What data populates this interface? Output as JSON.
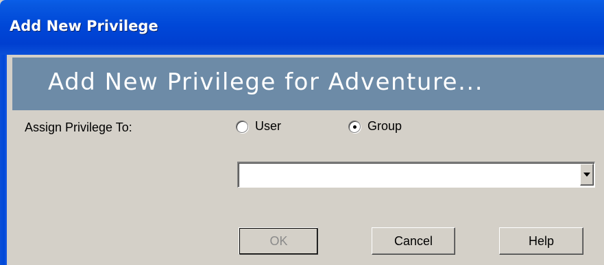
{
  "window": {
    "title": "Add New Privilege"
  },
  "header": {
    "title": "Add New Privilege for Adventure..."
  },
  "form": {
    "assign_label": "Assign Privilege To:",
    "options": [
      {
        "label": "User",
        "selected": false
      },
      {
        "label": "Group",
        "selected": true
      }
    ],
    "dropdown_value": ""
  },
  "buttons": {
    "ok": {
      "label": "OK",
      "enabled": false
    },
    "cancel": {
      "label": "Cancel",
      "enabled": true
    },
    "help": {
      "label": "Help",
      "enabled": true
    }
  },
  "colors": {
    "titlebar": "#0048d8",
    "banner": "#6d8ba7",
    "dialog_bg": "#d4d0c8"
  }
}
